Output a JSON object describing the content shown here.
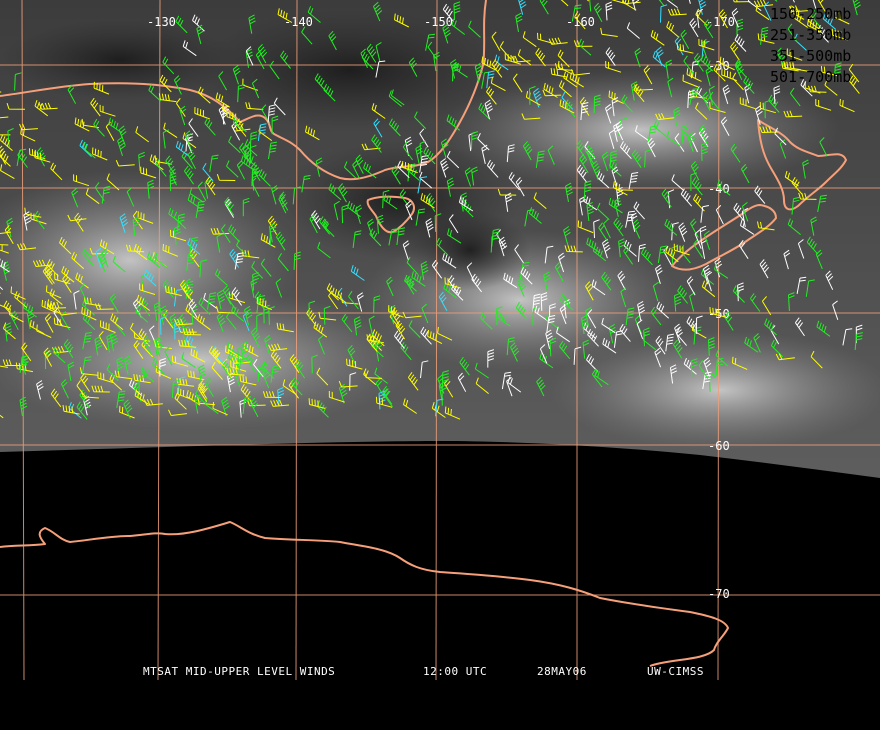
{
  "map": {
    "grid_color": "#f0a07a",
    "coast_color": "#f5a07a",
    "longitude_labels": [
      "-130",
      "-140",
      "-150",
      "-160",
      "-170"
    ],
    "latitude_labels": [
      "-30",
      "-40",
      "-50",
      "-60",
      "-70"
    ]
  },
  "legend": [
    {
      "label": "150-250mb",
      "color": "#33e0ff"
    },
    {
      "label": "251-350mb",
      "color": "#ffff00"
    },
    {
      "label": "351-500mb",
      "color": "#22ee22"
    },
    {
      "label": "501-700mb",
      "color": "#ffffff"
    }
  ],
  "caption": {
    "product": "MTSAT MID-UPPER LEVEL WINDS",
    "time": "12:00 UTC",
    "date": "28MAY06",
    "source": "UW-CIMSS"
  }
}
